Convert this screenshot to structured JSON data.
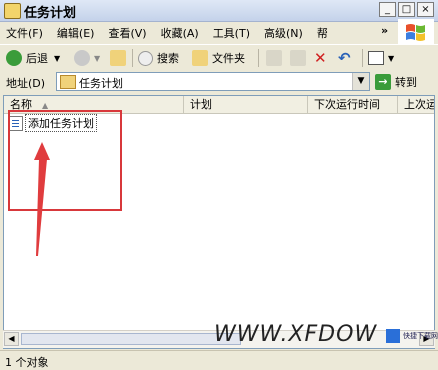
{
  "window": {
    "title": "任务计划",
    "controls": [
      "_",
      "□",
      "×"
    ]
  },
  "menubar": {
    "items": [
      "文件(F)",
      "编辑(E)",
      "查看(V)",
      "收藏(A)",
      "工具(T)",
      "高级(N)",
      "帮"
    ],
    "overflow": "»"
  },
  "toolbar": {
    "back_label": "后退",
    "search_label": "搜索",
    "folders_label": "文件夹"
  },
  "address": {
    "label": "地址(D)",
    "value": "任务计划",
    "go_label": "转到"
  },
  "columns": [
    "名称",
    "计划",
    "下次运行时间",
    "上次运"
  ],
  "items": [
    {
      "label": "添加任务计划"
    }
  ],
  "watermark": {
    "text": "WWW.XFDOW",
    "site": "快捷下载网"
  },
  "status": {
    "text": "1 个对象"
  },
  "colors": {
    "highlight": "#d8383b",
    "arrow": "#e03c3e"
  }
}
